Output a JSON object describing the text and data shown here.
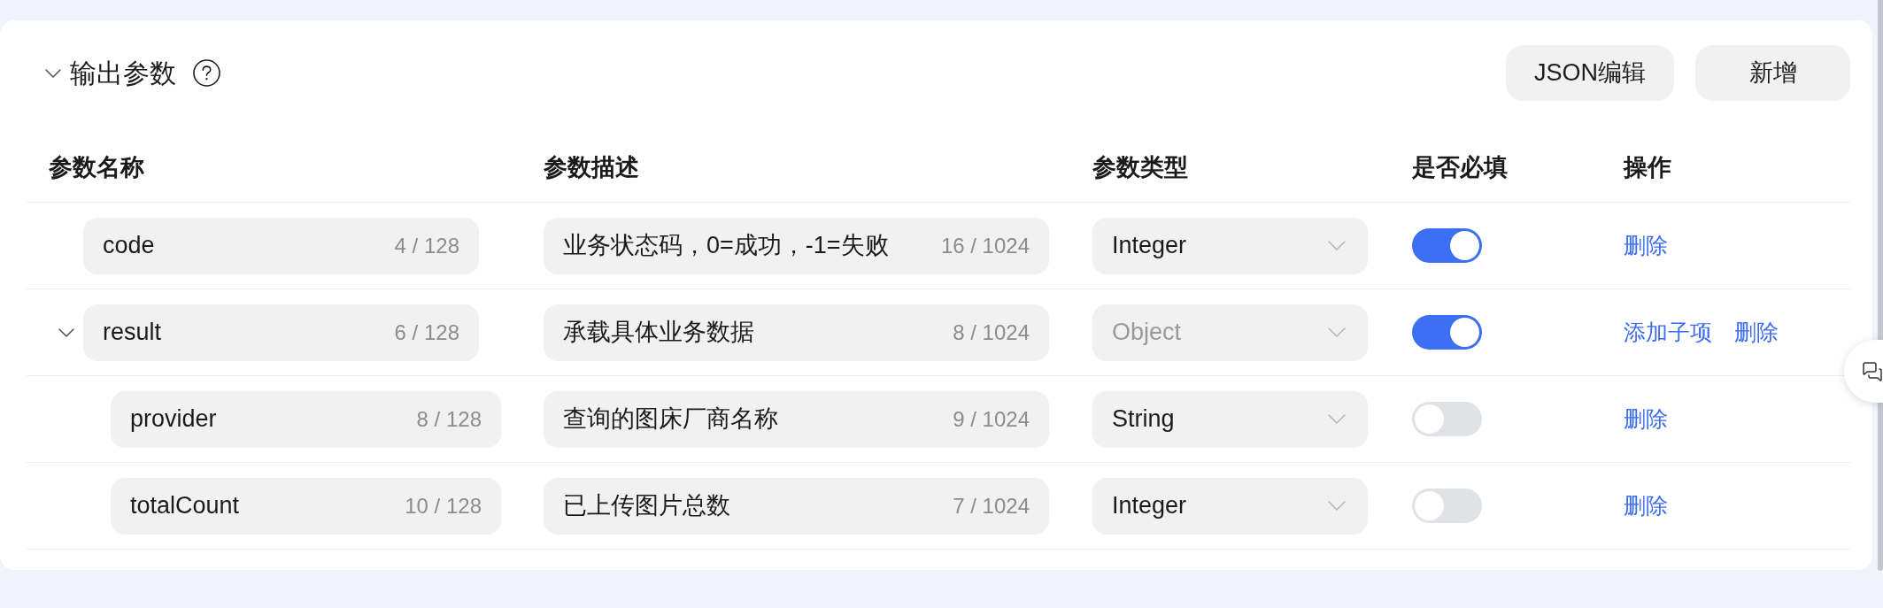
{
  "section": {
    "title": "输出参数",
    "expanded": true,
    "buttons": [
      "JSON编辑",
      "新增"
    ]
  },
  "table": {
    "columns": [
      "参数名称",
      "参数描述",
      "参数类型",
      "是否必填",
      "操作"
    ],
    "rows": [
      {
        "name": "code",
        "name_count": "4 / 128",
        "description": "业务状态码，0=成功，-1=失败",
        "description_count": "16 / 1024",
        "type": {
          "value": "Integer",
          "disabled": false
        },
        "required": true,
        "actions": [
          "删除"
        ]
      },
      {
        "name": "result",
        "name_count": "6 / 128",
        "description": "承载具体业务数据",
        "description_count": "8 / 1024",
        "type": {
          "value": "Object",
          "disabled": true
        },
        "required": true,
        "actions": [
          "添加子项",
          "删除"
        ],
        "expanded": true,
        "children": [
          {
            "name": "provider",
            "name_count": "8 / 128",
            "description": "查询的图床厂商名称",
            "description_count": "9 / 1024",
            "type": {
              "value": "String",
              "disabled": false
            },
            "required": false,
            "actions": [
              "删除"
            ]
          },
          {
            "name": "totalCount",
            "name_count": "10 / 128",
            "description": "已上传图片总数",
            "description_count": "7 / 1024",
            "type": {
              "value": "Integer",
              "disabled": false
            },
            "required": false,
            "actions": [
              "删除"
            ]
          }
        ]
      }
    ]
  }
}
